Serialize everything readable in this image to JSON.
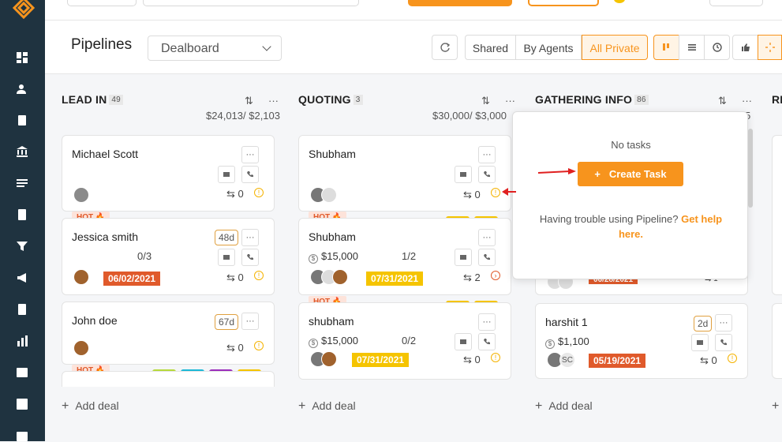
{
  "header": {
    "title": "Pipelines",
    "pipeline_select": "Dealboard",
    "view_filters": [
      "Shared",
      "By Agents",
      "All Private"
    ],
    "active_filter": "All Private"
  },
  "columns": [
    {
      "title": "LEAD IN",
      "count": "49",
      "sum": "$24,013/ $2,103",
      "add_label": "Add deal"
    },
    {
      "title": "QUOTING",
      "count": "3",
      "sum": "$30,000/ $3,000",
      "add_label": "Add deal"
    },
    {
      "title": "GATHERING INFO",
      "count": "86",
      "sum": "5",
      "add_label": "Add deal"
    },
    {
      "title": "RE",
      "count": "",
      "sum": "",
      "add_label": ""
    }
  ],
  "cards": {
    "lead1": {
      "name": "Michael Scott",
      "count": "0"
    },
    "lead2": {
      "hot": "HOT",
      "name": "Jessica smith",
      "days": "48d",
      "fraction": "0/3",
      "date": "06/02/2021",
      "count": "0"
    },
    "lead3": {
      "name": "John doe",
      "days": "67d",
      "count": "0"
    },
    "lead4": {
      "hot": "HOT"
    },
    "quote1": {
      "name": "Shubham",
      "count": "0"
    },
    "quote2": {
      "hot": "HOT",
      "name": "Shubham",
      "amount": "$15,000",
      "fraction": "1/2",
      "date": "07/31/2021",
      "count": "2"
    },
    "quote3": {
      "hot": "HOT",
      "name": "shubham",
      "amount": "$15,000",
      "fraction": "0/2",
      "date": "07/31/2021",
      "count": "0"
    },
    "gather1": {
      "date": "06/28/2021",
      "count": "1"
    },
    "gather2": {
      "name": "harshit 1",
      "days": "2d",
      "amount": "$1,100",
      "initials": "SC",
      "date": "05/19/2021",
      "count": "0"
    }
  },
  "popover": {
    "empty_text": "No tasks",
    "create_button": "Create Task",
    "help_text": "Having trouble using Pipeline?",
    "help_link": "Get help here."
  },
  "colors": {
    "accent": "#f7941d",
    "sidebar": "#1f3340",
    "date_red": "#e05a2b",
    "date_yellow": "#f5c400"
  }
}
